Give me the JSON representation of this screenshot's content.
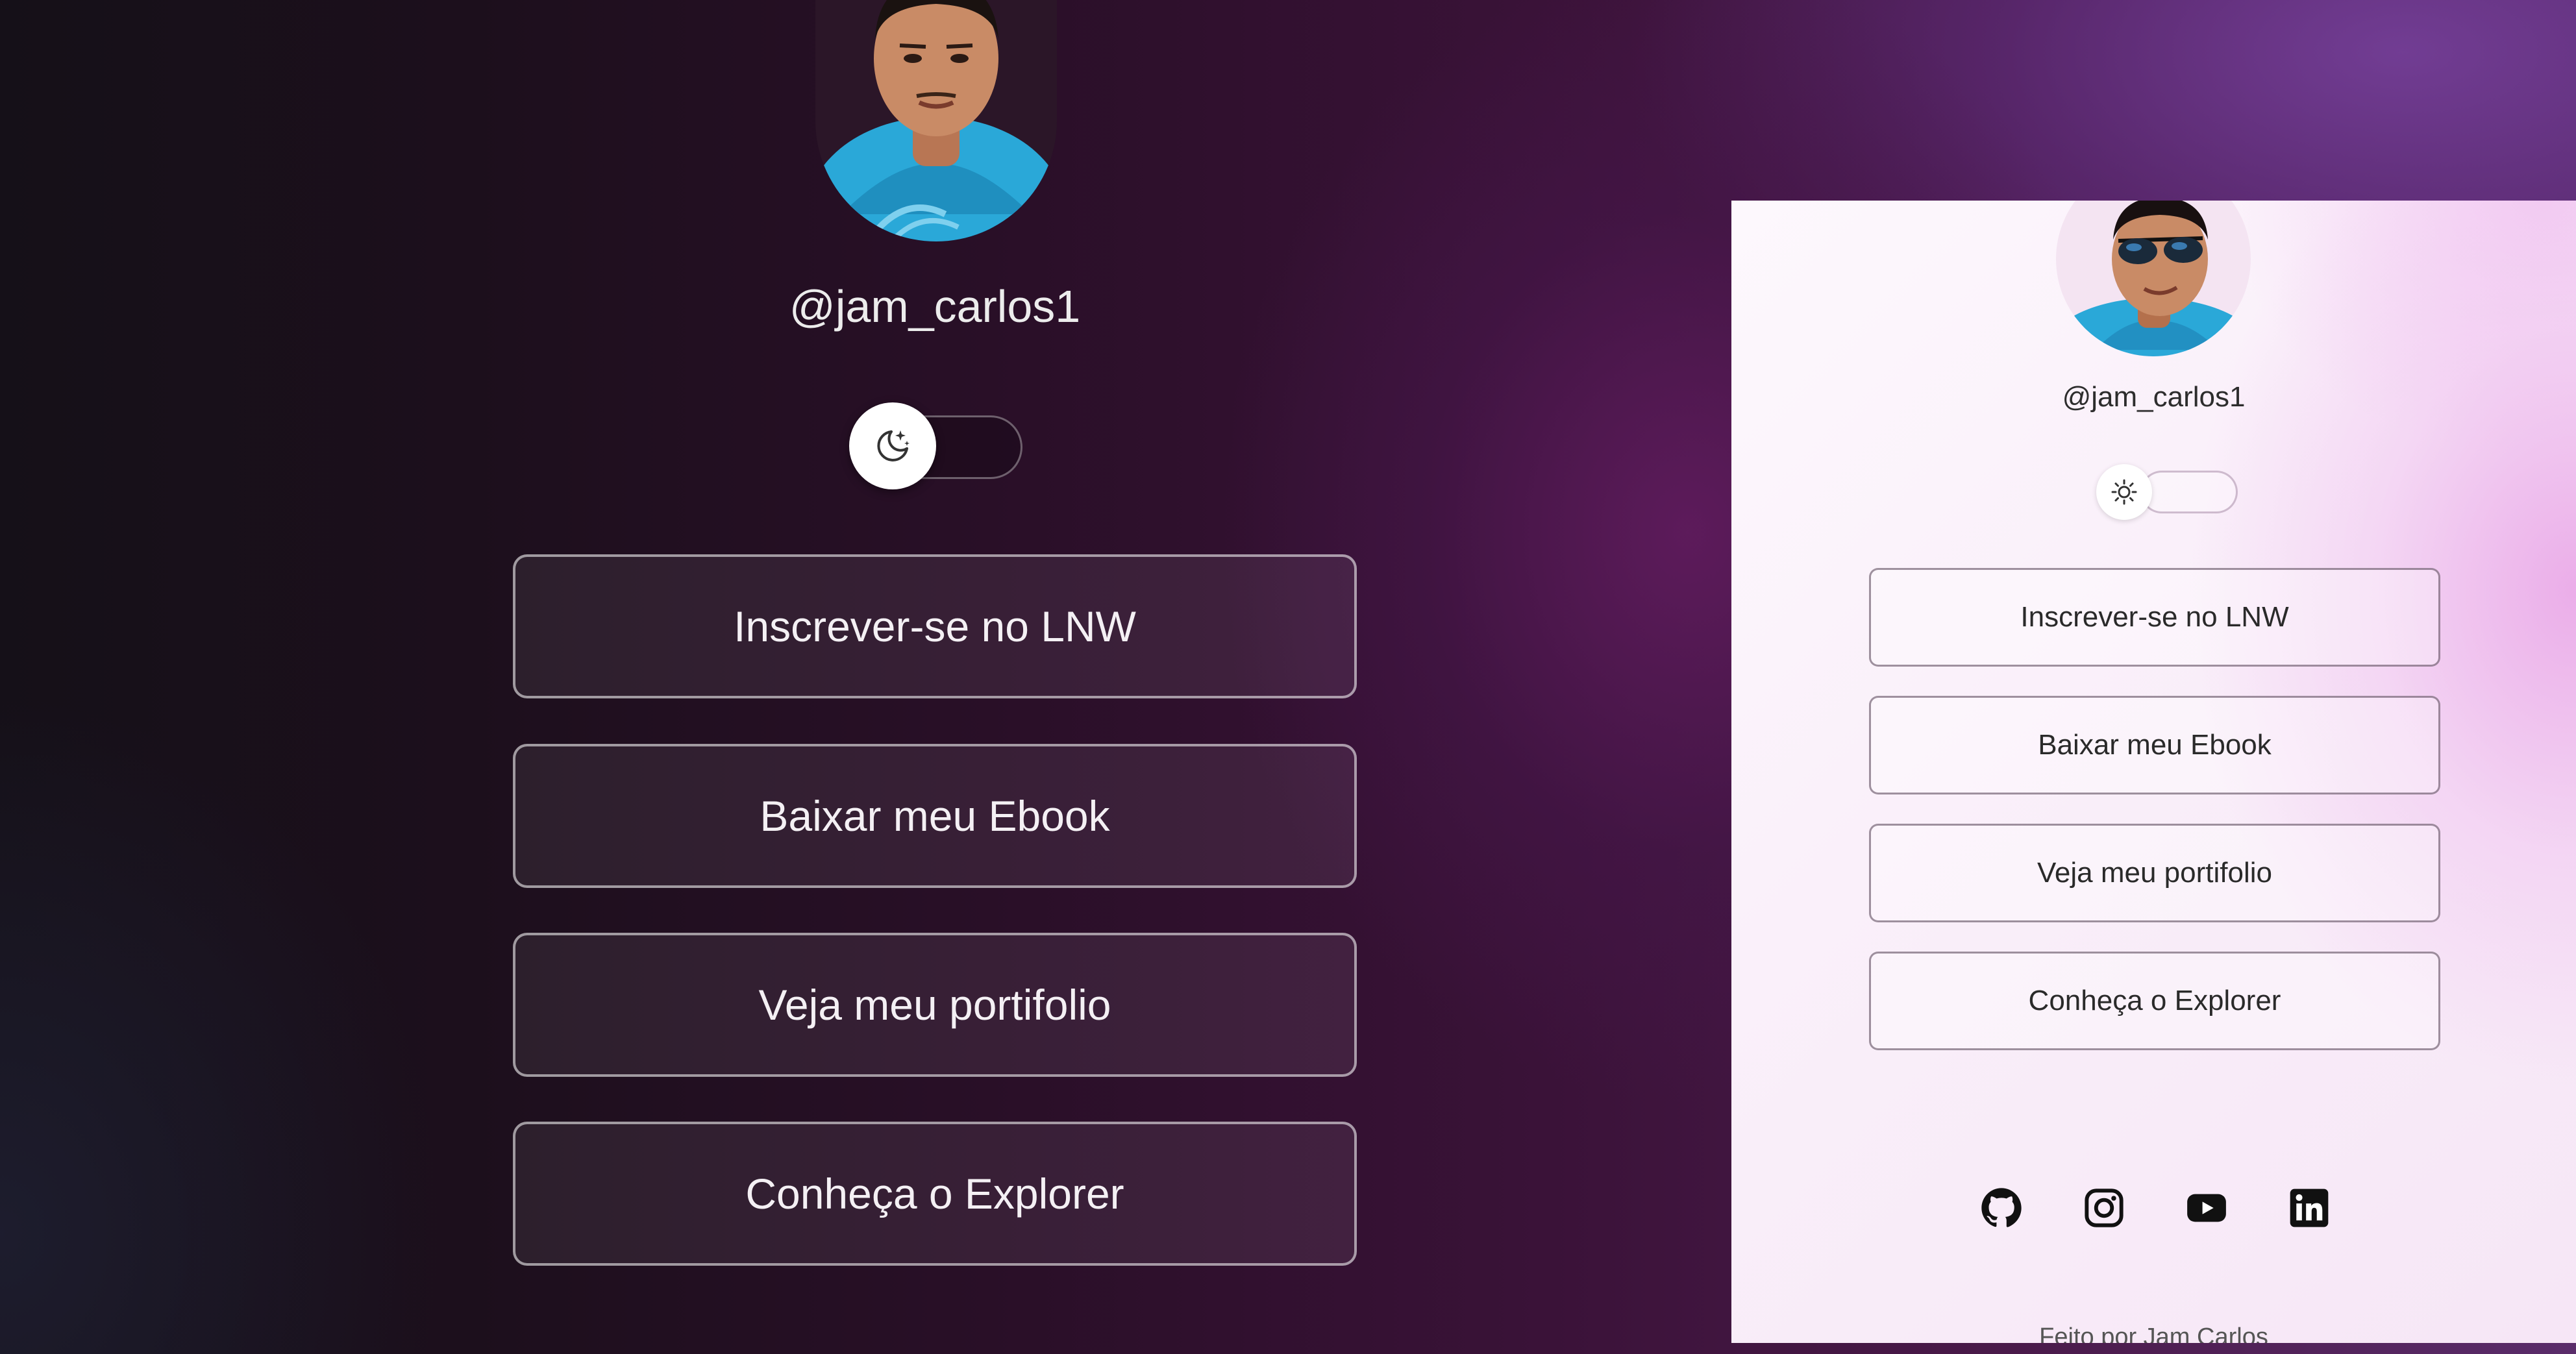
{
  "dark_preview": {
    "username": "@jam_carlos1",
    "theme_toggle": {
      "icon": "moon-stars-icon",
      "mode": "dark"
    },
    "links": [
      {
        "label": "Inscrever-se no LNW"
      },
      {
        "label": "Baixar meu Ebook"
      },
      {
        "label": "Veja meu portifolio"
      },
      {
        "label": "Conheça o Explorer"
      }
    ]
  },
  "light_preview": {
    "username": "@jam_carlos1",
    "theme_toggle": {
      "icon": "sun-icon",
      "mode": "light"
    },
    "links": [
      {
        "label": "Inscrever-se no LNW"
      },
      {
        "label": "Baixar meu Ebook"
      },
      {
        "label": "Veja meu portifolio"
      },
      {
        "label": "Conheça o Explorer"
      }
    ],
    "social": [
      {
        "icon": "github-icon"
      },
      {
        "icon": "instagram-icon"
      },
      {
        "icon": "youtube-icon"
      },
      {
        "icon": "linkedin-icon"
      }
    ],
    "footer": "Feito por Jam Carlos"
  },
  "colors": {
    "dark_bg": "#2a0f28",
    "dark_accent": "#5a1a58",
    "light_bg": "#fdf8fd",
    "light_accent": "#eab0ea",
    "avatar_shirt": "#2aa8d8",
    "skin": "#c98b66"
  }
}
